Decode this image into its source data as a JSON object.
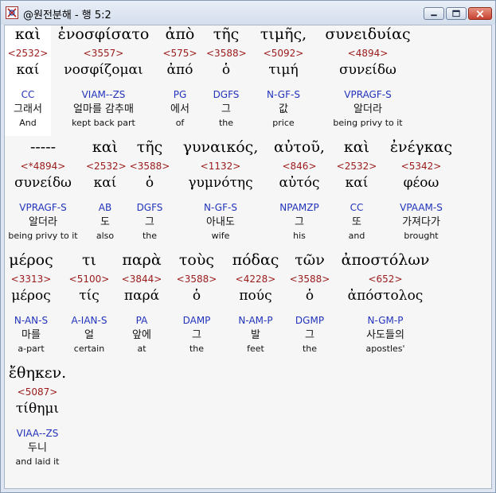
{
  "window": {
    "title": "@원전분해 - 행 5:2"
  },
  "rows": [
    [
      {
        "greek": "καὶ",
        "num": "<2532>",
        "lemma": "καί",
        "morph": "CC",
        "kor": "그래서",
        "eng": "And"
      },
      {
        "greek": "ἐνοσφίσατο",
        "num": "<3557>",
        "lemma": "νοσφίζομαι",
        "morph": "VIAM--ZS",
        "kor": "얼마를 감추매",
        "eng": "kept back part"
      },
      {
        "greek": "ἀπὸ",
        "num": "<575>",
        "lemma": "ἀπό",
        "morph": "PG",
        "kor": "에서",
        "eng": "of"
      },
      {
        "greek": "τῆς",
        "num": "<3588>",
        "lemma": "ὁ",
        "morph": "DGFS",
        "kor": "그",
        "eng": "the"
      },
      {
        "greek": "τιμῆς,",
        "num": "<5092>",
        "lemma": "τιμή",
        "morph": "N-GF-S",
        "kor": "값",
        "eng": "price"
      },
      {
        "greek": "συνειδυίας",
        "num": "<4894>",
        "lemma": "συνείδω",
        "morph": "VPRAGF-S",
        "kor": "알더라",
        "eng": "being privy to it"
      }
    ],
    [
      {
        "greek": "-----",
        "num": "<*4894>",
        "lemma": "συνείδω",
        "morph": "VPRAGF-S",
        "kor": "알더라",
        "eng": "being privy to it"
      },
      {
        "greek": "καὶ",
        "num": "<2532>",
        "lemma": "καί",
        "morph": "AB",
        "kor": "도",
        "eng": "also"
      },
      {
        "greek": "τῆς",
        "num": "<3588>",
        "lemma": "ὁ",
        "morph": "DGFS",
        "kor": "그",
        "eng": "the"
      },
      {
        "greek": "γυναικός,",
        "num": "<1132>",
        "lemma": "γυμνότης",
        "morph": "N-GF-S",
        "kor": "아내도",
        "eng": "wife"
      },
      {
        "greek": "αὐτοῦ,",
        "num": "<846>",
        "lemma": "αὐτός",
        "morph": "NPAMZP",
        "kor": "그",
        "eng": "his"
      },
      {
        "greek": "καὶ",
        "num": "<2532>",
        "lemma": "καί",
        "morph": "CC",
        "kor": "또",
        "eng": "and"
      },
      {
        "greek": "ἐνέγκας",
        "num": "<5342>",
        "lemma": "φέοω",
        "morph": "VPAAM-S",
        "kor": "가져다가",
        "eng": "brought"
      }
    ],
    [
      {
        "greek": "μέρος",
        "num": "<3313>",
        "lemma": "μέρος",
        "morph": "N-AN-S",
        "kor": "마를",
        "eng": "a-part"
      },
      {
        "greek": "τι",
        "num": "<5100>",
        "lemma": "τίς",
        "morph": "A-IAN-S",
        "kor": "얼",
        "eng": "certain"
      },
      {
        "greek": "παρὰ",
        "num": "<3844>",
        "lemma": "παρά",
        "morph": "PA",
        "kor": "앞에",
        "eng": "at"
      },
      {
        "greek": "τοὺς",
        "num": "<3588>",
        "lemma": "ὁ",
        "morph": "DAMP",
        "kor": "그",
        "eng": "the"
      },
      {
        "greek": "πόδας",
        "num": "<4228>",
        "lemma": "πούς",
        "morph": "N-AM-P",
        "kor": "발",
        "eng": "feet"
      },
      {
        "greek": "τῶν",
        "num": "<3588>",
        "lemma": "ὁ",
        "morph": "DGMP",
        "kor": "그",
        "eng": "the"
      },
      {
        "greek": "ἀποστόλων",
        "num": "<652>",
        "lemma": "ἀπόστολος",
        "morph": "N-GM-P",
        "kor": "사도들의",
        "eng": "apostles'"
      }
    ],
    [
      {
        "greek": "ἔθηκεν.",
        "num": "<5087>",
        "lemma": "τίθημι",
        "morph": "VIAA--ZS",
        "kor": "두니",
        "eng": "and laid it"
      }
    ]
  ]
}
